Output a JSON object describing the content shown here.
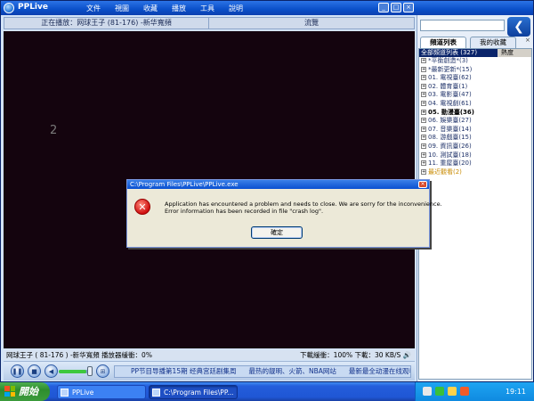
{
  "window": {
    "app_title": "PPLive",
    "menu": [
      "文件",
      "視圖",
      "收藏",
      "播放",
      "工具",
      "說明"
    ],
    "buttons": {
      "minimize": "_",
      "maximize": "□",
      "close": "×"
    }
  },
  "player": {
    "now_playing": "正在播放：网球王子 (81-176) -新华寬頻",
    "browse_tab": "流覽",
    "channel_number": "2"
  },
  "status": {
    "left": "网球王子 ( 81-176 ) -新华寬頻  播放器緩衝：0%",
    "right": "下載緩衝：100%   下載：30 KB/S   🔊"
  },
  "controls": {
    "pause": "❚❚",
    "stop": "■",
    "volume": "◀",
    "screen": "⊞",
    "volume_level": 0.85,
    "ticker": [
      "PP节目导播第15期 经典宫廷剧集周",
      "最热的靓明、火箭、NBA网站",
      "最新最全动漫在线观看",
      "记"
    ]
  },
  "sidebar": {
    "search_placeholder": "",
    "close_label": "×",
    "tabs": [
      "頻道列表",
      "我的收藏"
    ],
    "header": {
      "name": "全部頻道列表 (327)",
      "heat": "熱度"
    },
    "items": [
      {
        "label": "*平衡創造*(3)",
        "style": "normal"
      },
      {
        "label": "*最新更新*(15)",
        "style": "normal"
      },
      {
        "label": "01. 電視臺(62)",
        "style": "normal"
      },
      {
        "label": "02. 體育臺(1)",
        "style": "normal"
      },
      {
        "label": "03. 電影臺(47)",
        "style": "normal"
      },
      {
        "label": "04. 電視劇(61)",
        "style": "normal"
      },
      {
        "label": "05. 動漫臺(36)",
        "style": "bold"
      },
      {
        "label": "06. 娛樂臺(27)",
        "style": "normal"
      },
      {
        "label": "07. 音樂臺(14)",
        "style": "normal"
      },
      {
        "label": "08. 游戲臺(15)",
        "style": "normal"
      },
      {
        "label": "09. 資訊臺(26)",
        "style": "normal"
      },
      {
        "label": "10. 測試臺(18)",
        "style": "normal"
      },
      {
        "label": "11. 重屋臺(20)",
        "style": "normal"
      },
      {
        "label": "最近觀看(2)",
        "style": "recent"
      }
    ]
  },
  "dialog": {
    "title": "C:\\Program Files\\PPLive\\PPLive.exe",
    "close": "×",
    "icon": "✕",
    "line1": "Application has encountered a problem and needs to close. We are sorry for the inconvenience.",
    "line2": "Error information has been recorded in file \"crash log\".",
    "ok_label": "確定"
  },
  "taskbar": {
    "start_label": "開始",
    "tasks": [
      "PPLive",
      "C:\\Program Files\\PP..."
    ],
    "clock": "19:11"
  },
  "colors": {
    "flag": [
      "#f25022",
      "#7fba00",
      "#00a4ef",
      "#ffb900"
    ],
    "tray": [
      "#e8e8e8",
      "#39c03a",
      "#ffd24a",
      "#f25b2a"
    ]
  }
}
